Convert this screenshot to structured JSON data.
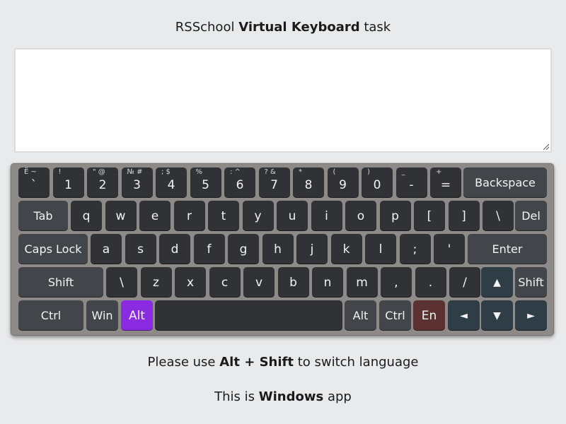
{
  "header": {
    "prefix": "RSSchool",
    "bold": "Virtual Keyboard",
    "suffix": "task"
  },
  "textarea": {
    "value": ""
  },
  "keyboard": {
    "row1": [
      {
        "main": "`",
        "sub": "Ё ~"
      },
      {
        "main": "1",
        "sub": "!"
      },
      {
        "main": "2",
        "sub": "\" @"
      },
      {
        "main": "3",
        "sub": "№ #"
      },
      {
        "main": "4",
        "sub": "; $"
      },
      {
        "main": "5",
        "sub": "%"
      },
      {
        "main": "6",
        "sub": ": ^"
      },
      {
        "main": "7",
        "sub": "? &"
      },
      {
        "main": "8",
        "sub": "*"
      },
      {
        "main": "9",
        "sub": "("
      },
      {
        "main": "0",
        "sub": ")"
      },
      {
        "main": "-",
        "sub": "_"
      },
      {
        "main": "=",
        "sub": "+"
      },
      {
        "main": "Backspace",
        "sub": ""
      }
    ],
    "row2": [
      "Tab",
      "q",
      "w",
      "e",
      "r",
      "t",
      "y",
      "u",
      "i",
      "o",
      "p",
      "[",
      "]",
      "\\",
      "Del"
    ],
    "row3": [
      "Caps Lock",
      "a",
      "s",
      "d",
      "f",
      "g",
      "h",
      "j",
      "k",
      "l",
      ";",
      "'",
      "Enter"
    ],
    "row4": [
      "Shift",
      "\\",
      "z",
      "x",
      "c",
      "v",
      "b",
      "n",
      "m",
      ",",
      ".",
      "/",
      "▲",
      "Shift"
    ],
    "row5": [
      "Ctrl",
      "Win",
      "Alt",
      "",
      "Alt",
      "Ctrl",
      "En",
      "◄",
      "▼",
      "►"
    ]
  },
  "colors": {
    "key": "#303235",
    "modifier_key": "#42464a",
    "alt_active": "#8a2be2",
    "language_key": "#5b3231",
    "arrow_key": "#2f3d47"
  },
  "hint": {
    "before": "Please use",
    "bold": "Alt + Shift",
    "after": "to switch language"
  },
  "platform": {
    "before": "This is",
    "bold": "Windows",
    "after": "app"
  }
}
